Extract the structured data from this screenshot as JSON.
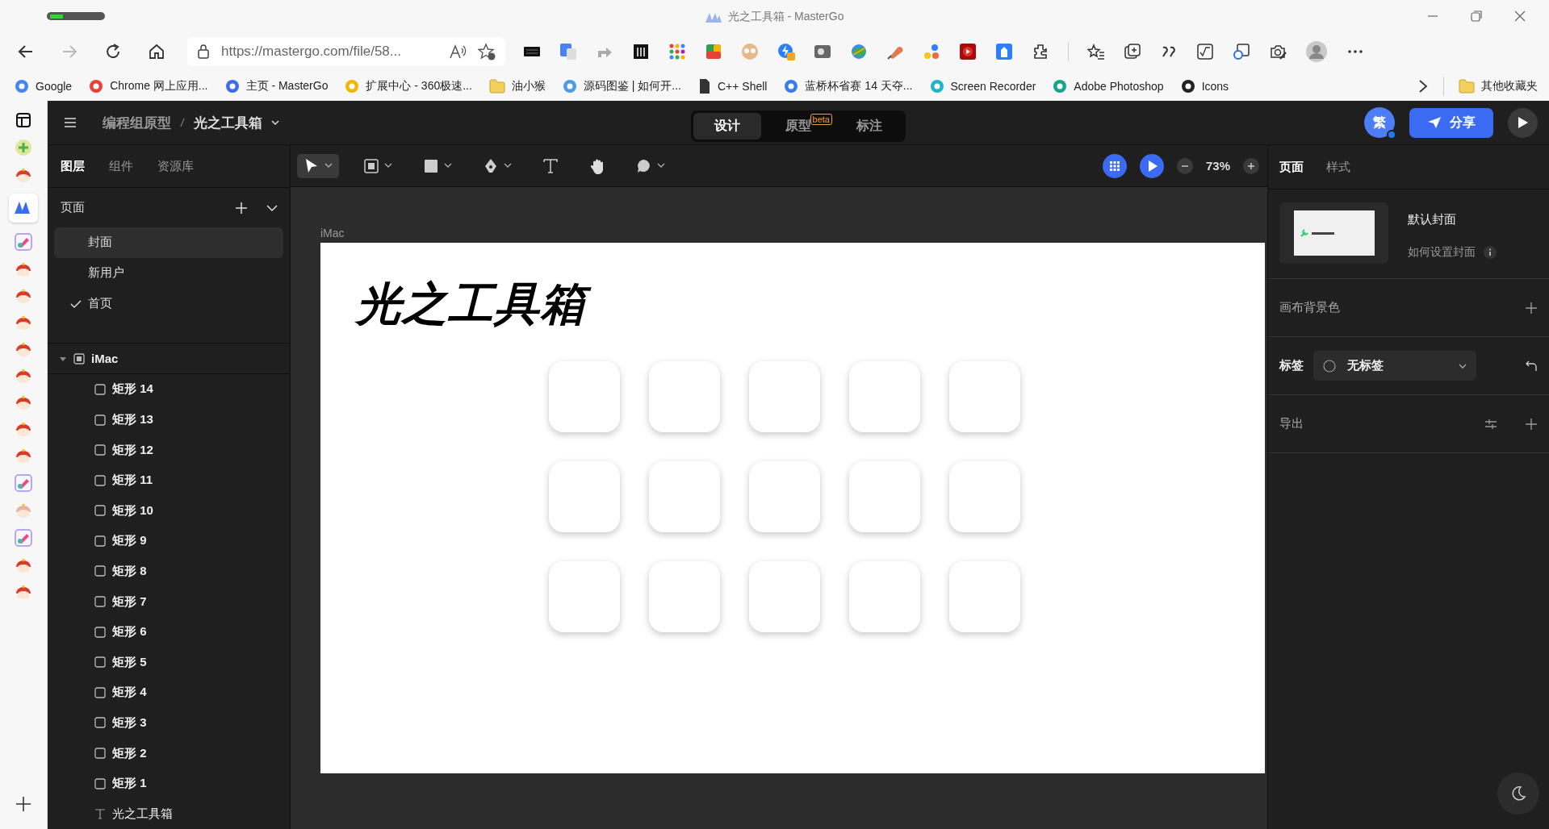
{
  "browser": {
    "title": "光之工具箱 - MasterGo",
    "url": "https://mastergo.com/file/58...",
    "bookmarks": [
      {
        "label": "Google",
        "kind": "site",
        "color": "#4285f4"
      },
      {
        "label": "Chrome 网上应用...",
        "kind": "site",
        "color": "#e94235"
      },
      {
        "label": "主页 - MasterGo",
        "kind": "site",
        "color": "#3c6df0"
      },
      {
        "label": "扩展中心 - 360极速...",
        "kind": "site",
        "color": "#f4b400"
      },
      {
        "label": "油小猴",
        "kind": "folder",
        "color": "#f5cf5b"
      },
      {
        "label": "源码图鉴 | 如何开...",
        "kind": "site",
        "color": "#4a9bea"
      },
      {
        "label": "C++ Shell",
        "kind": "page",
        "color": "#333333"
      },
      {
        "label": "蓝桥杯省赛 14 天夺...",
        "kind": "site",
        "color": "#3a7bf0"
      },
      {
        "label": "Screen Recorder",
        "kind": "site",
        "color": "#1cb5c9"
      },
      {
        "label": "Adobe Photoshop",
        "kind": "site",
        "color": "#14a38b"
      },
      {
        "label": "Icons",
        "kind": "site",
        "color": "#222222"
      }
    ],
    "other_bookmarks": {
      "label": "其他收藏夹",
      "kind": "folder",
      "color": "#f5cf5b"
    }
  },
  "app": {
    "breadcrumb": {
      "team": "编程组原型",
      "file": "光之工具箱"
    },
    "mode_tabs": [
      {
        "label": "设计",
        "selected": true
      },
      {
        "label": "原型",
        "badge": "beta",
        "selected": false
      },
      {
        "label": "标注",
        "selected": false
      }
    ],
    "avatar": "繁",
    "share": "分享",
    "zoom": "73%"
  },
  "left_panel": {
    "tabs": [
      {
        "label": "图层",
        "selected": true
      },
      {
        "label": "组件",
        "selected": false
      },
      {
        "label": "资源库",
        "selected": false
      }
    ],
    "pages_title": "页面",
    "pages": [
      {
        "label": "封面",
        "selected": true,
        "checked": false
      },
      {
        "label": "新用户",
        "selected": false,
        "checked": false
      },
      {
        "label": "首页",
        "selected": false,
        "checked": true
      }
    ],
    "layers": [
      {
        "label": "iMac",
        "kind": "frame",
        "expanded": true,
        "children": [
          {
            "label": "矩形 14",
            "kind": "rect"
          },
          {
            "label": "矩形 13",
            "kind": "rect"
          },
          {
            "label": "矩形 12",
            "kind": "rect"
          },
          {
            "label": "矩形 11",
            "kind": "rect"
          },
          {
            "label": "矩形 10",
            "kind": "rect"
          },
          {
            "label": "矩形 9",
            "kind": "rect"
          },
          {
            "label": "矩形 8",
            "kind": "rect"
          },
          {
            "label": "矩形 7",
            "kind": "rect"
          },
          {
            "label": "矩形 6",
            "kind": "rect"
          },
          {
            "label": "矩形 5",
            "kind": "rect"
          },
          {
            "label": "矩形 4",
            "kind": "rect"
          },
          {
            "label": "矩形 3",
            "kind": "rect"
          },
          {
            "label": "矩形 2",
            "kind": "rect"
          },
          {
            "label": "矩形 1",
            "kind": "rect"
          },
          {
            "label": "光之工具箱",
            "kind": "text"
          }
        ]
      }
    ]
  },
  "canvas": {
    "frame_label": "iMac",
    "heading": "光之工具箱",
    "tiles": [
      {
        "kind": "rounded-square"
      },
      {
        "kind": "rounded-square"
      },
      {
        "kind": "rounded-square"
      },
      {
        "kind": "rounded-square"
      },
      {
        "kind": "rounded-square"
      },
      {
        "kind": "rounded-square"
      },
      {
        "kind": "rounded-square"
      },
      {
        "kind": "rounded-square"
      },
      {
        "kind": "rounded-square"
      },
      {
        "kind": "rounded-square"
      },
      {
        "kind": "rounded-square"
      },
      {
        "kind": "rounded-square"
      },
      {
        "kind": "rounded-square"
      },
      {
        "kind": "rounded-square"
      },
      {
        "kind": "rounded-square"
      }
    ]
  },
  "right_panel": {
    "tabs": [
      {
        "label": "页面",
        "selected": true
      },
      {
        "label": "样式",
        "selected": false
      }
    ],
    "cover_title": "默认封面",
    "cover_help": "如何设置封面",
    "canvas_bg_label": "画布背景色",
    "tag_label": "标签",
    "tag_value": "无标签",
    "export_label": "导出"
  }
}
